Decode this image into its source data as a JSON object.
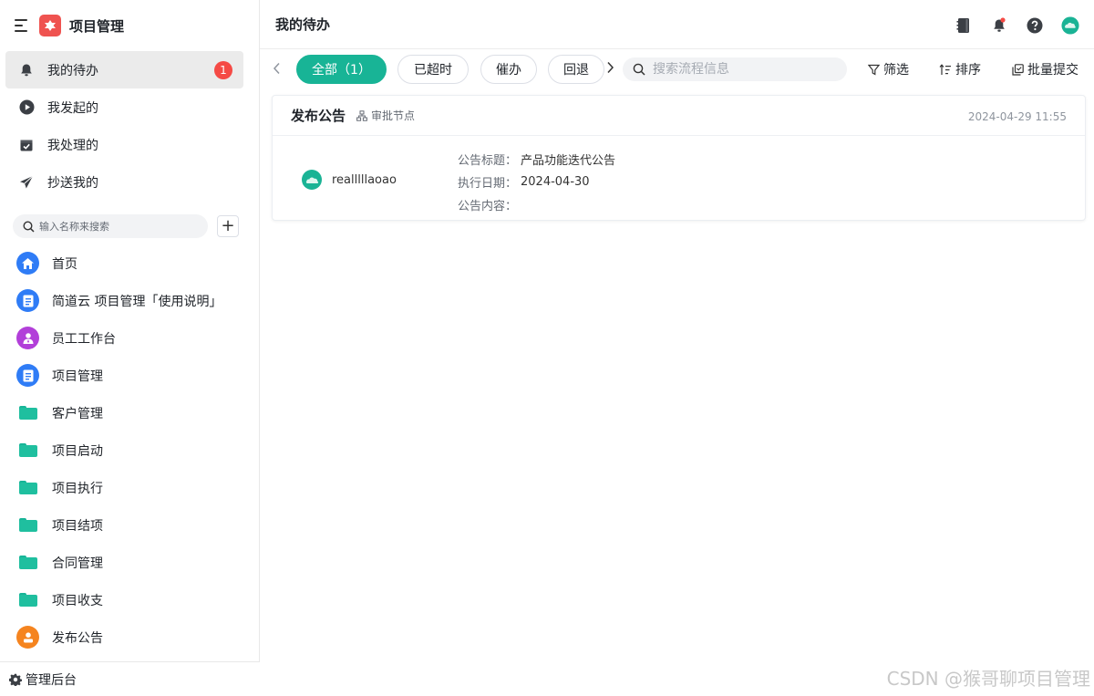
{
  "sidebar": {
    "app_title": "项目管理",
    "nav": [
      {
        "label": "我的待办",
        "badge": "1"
      },
      {
        "label": "我发起的"
      },
      {
        "label": "我处理的"
      },
      {
        "label": "抄送我的"
      }
    ],
    "search_placeholder": "输入名称来搜索",
    "add_label": "+",
    "apps": [
      {
        "label": "首页",
        "icon": "home-icon",
        "color": "#2f7cf6"
      },
      {
        "label": "简道云 项目管理「使用说明」",
        "icon": "document-icon",
        "color": "#2f7cf6"
      },
      {
        "label": "员工工作台",
        "icon": "person-icon",
        "color": "#b23fd9"
      },
      {
        "label": "项目管理",
        "icon": "document-icon",
        "color": "#2f7cf6"
      },
      {
        "label": "客户管理",
        "icon": "folder-icon",
        "color": "#1fbf9f"
      },
      {
        "label": "项目启动",
        "icon": "folder-icon",
        "color": "#1fbf9f"
      },
      {
        "label": "项目执行",
        "icon": "folder-icon",
        "color": "#1fbf9f"
      },
      {
        "label": "项目结项",
        "icon": "folder-icon",
        "color": "#1fbf9f"
      },
      {
        "label": "合同管理",
        "icon": "folder-icon",
        "color": "#1fbf9f"
      },
      {
        "label": "项目收支",
        "icon": "folder-icon",
        "color": "#1fbf9f"
      },
      {
        "label": "发布公告",
        "icon": "person-stamp-icon",
        "color": "#f5841f"
      }
    ],
    "footer_label": "管理后台"
  },
  "header": {
    "title": "我的待办"
  },
  "filters": {
    "tabs": [
      {
        "label": "全部（1）",
        "active": true
      },
      {
        "label": "已超时"
      },
      {
        "label": "催办"
      },
      {
        "label": "回退"
      }
    ],
    "search_placeholder": "搜索流程信息",
    "actions": {
      "filter": "筛选",
      "sort": "排序",
      "batch": "批量提交"
    }
  },
  "task": {
    "title": "发布公告",
    "node": "审批节点",
    "time": "2024-04-29 11:55",
    "user": "realllllaoao",
    "fields": [
      {
        "label": "公告标题：",
        "value": "产品功能迭代公告"
      },
      {
        "label": "执行日期：",
        "value": "2024-04-30"
      },
      {
        "label": "公告内容：",
        "value": ""
      }
    ]
  },
  "watermark": "CSDN @猴哥聊项目管理",
  "colors": {
    "accent": "#18b496",
    "badge": "#f54a45",
    "logo": "#ef5350"
  }
}
